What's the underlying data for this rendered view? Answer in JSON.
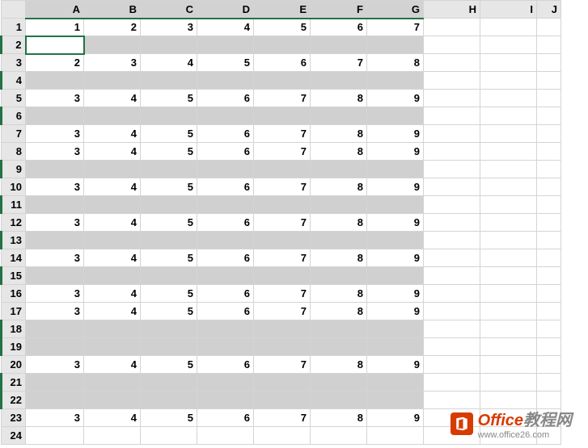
{
  "columns": [
    "A",
    "B",
    "C",
    "D",
    "E",
    "F",
    "G",
    "H",
    "I",
    "J"
  ],
  "row_count": 24,
  "active_cell": {
    "row": 2,
    "col": "A"
  },
  "selection_cols": [
    "A",
    "B",
    "C",
    "D",
    "E",
    "F",
    "G"
  ],
  "blank_rows": [
    2,
    4,
    6,
    9,
    11,
    13,
    15,
    18,
    19,
    21,
    22
  ],
  "rows": {
    "1": {
      "A": "1",
      "B": "2",
      "C": "3",
      "D": "4",
      "E": "5",
      "F": "6",
      "G": "7"
    },
    "3": {
      "A": "2",
      "B": "3",
      "C": "4",
      "D": "5",
      "E": "6",
      "F": "7",
      "G": "8"
    },
    "5": {
      "A": "3",
      "B": "4",
      "C": "5",
      "D": "6",
      "E": "7",
      "F": "8",
      "G": "9"
    },
    "7": {
      "A": "3",
      "B": "4",
      "C": "5",
      "D": "6",
      "E": "7",
      "F": "8",
      "G": "9"
    },
    "8": {
      "A": "3",
      "B": "4",
      "C": "5",
      "D": "6",
      "E": "7",
      "F": "8",
      "G": "9"
    },
    "10": {
      "A": "3",
      "B": "4",
      "C": "5",
      "D": "6",
      "E": "7",
      "F": "8",
      "G": "9"
    },
    "12": {
      "A": "3",
      "B": "4",
      "C": "5",
      "D": "6",
      "E": "7",
      "F": "8",
      "G": "9"
    },
    "14": {
      "A": "3",
      "B": "4",
      "C": "5",
      "D": "6",
      "E": "7",
      "F": "8",
      "G": "9"
    },
    "16": {
      "A": "3",
      "B": "4",
      "C": "5",
      "D": "6",
      "E": "7",
      "F": "8",
      "G": "9"
    },
    "17": {
      "A": "3",
      "B": "4",
      "C": "5",
      "D": "6",
      "E": "7",
      "F": "8",
      "G": "9"
    },
    "20": {
      "A": "3",
      "B": "4",
      "C": "5",
      "D": "6",
      "E": "7",
      "F": "8",
      "G": "9"
    },
    "23": {
      "A": "3",
      "B": "4",
      "C": "5",
      "D": "6",
      "E": "7",
      "F": "8",
      "G": "9"
    }
  },
  "watermark": {
    "brand": "Office",
    "suffix": "教程网",
    "url": "www.office26.com"
  }
}
